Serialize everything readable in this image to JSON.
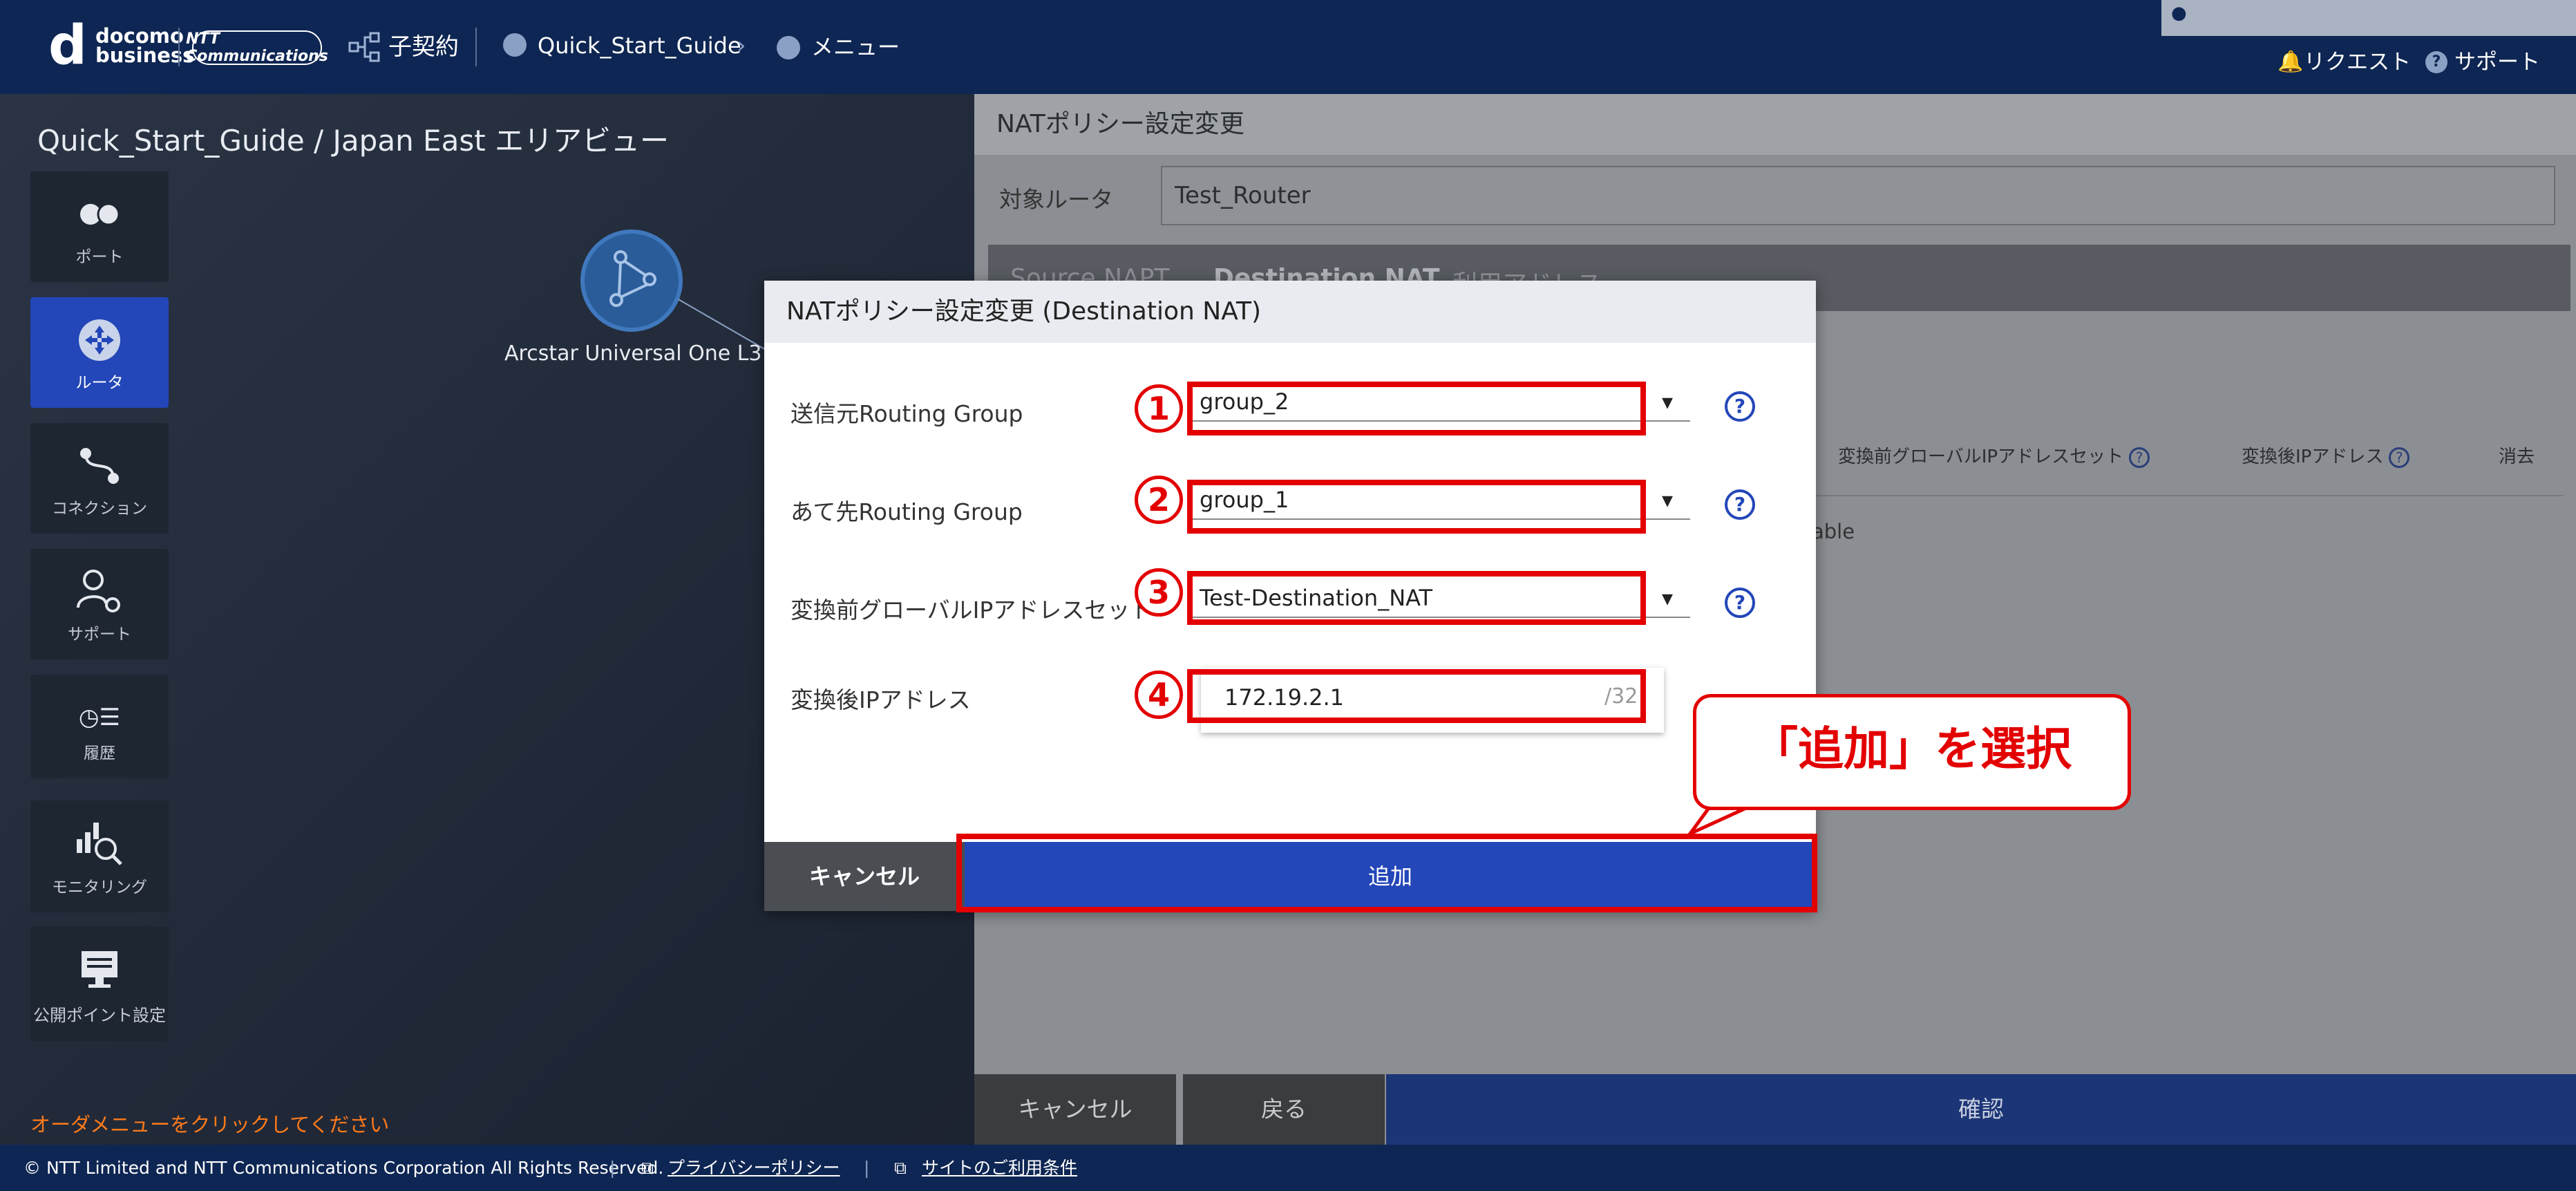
{
  "header": {
    "brand": "docomo business",
    "brand_line1": "docomo",
    "brand_line2": "business",
    "partner_logo": "NTT Communications",
    "nav_contract": "子契約",
    "nav_guide": "Quick_Start_Guide",
    "nav_menu": "メニュー",
    "request": "リクエスト",
    "support": "サポート"
  },
  "left": {
    "area_title": "Quick_Start_Guide / Japan East エリアビュー",
    "sidebar": [
      {
        "label": "ポート",
        "icon": "port-icon"
      },
      {
        "label": "ルータ",
        "icon": "router-icon"
      },
      {
        "label": "コネクション",
        "icon": "connection-icon"
      },
      {
        "label": "サポート",
        "icon": "support-icon"
      },
      {
        "label": "履歴",
        "icon": "history-icon"
      },
      {
        "label": "モニタリング",
        "icon": "monitoring-icon"
      },
      {
        "label": "公開ポイント設定",
        "icon": "public-point-icon"
      }
    ],
    "globe_label": "Arcstar Universal One L3",
    "order_message": "オーダメニューをクリックしてください"
  },
  "right": {
    "title": "NATポリシー設定変更",
    "target_router_label": "対象ルータ",
    "target_router_value": "Test_Router",
    "tabs": [
      "Source NAPT",
      "Destination NAT",
      "利用アドレス"
    ],
    "columns": {
      "pre_global": "変換前グローバルIPアドレスセット",
      "post_ip": "変換後IPアドレス",
      "delete": "消去"
    },
    "table_stub": "able",
    "cancel": "キャンセル",
    "back": "戻る",
    "confirm": "確認"
  },
  "dialog": {
    "title": "NATポリシー設定変更 (Destination NAT)",
    "fields": [
      {
        "label": "送信元Routing Group",
        "value": "group_2",
        "number": "1"
      },
      {
        "label": "あて先Routing Group",
        "value": "group_1",
        "number": "2"
      },
      {
        "label": "変換前グローバルIPアドレスセット",
        "value": "Test-Destination_NAT",
        "number": "3"
      },
      {
        "label": "変換後IPアドレス",
        "value": "172.19.2.1",
        "number": "4"
      }
    ],
    "ip_mask": "/32",
    "help": "?",
    "cancel": "キャンセル",
    "add": "追加"
  },
  "callout": "「追加」を選択",
  "footer": {
    "copyright": "© NTT Limited and NTT Communications Corporation All Rights Reserved.",
    "privacy": "プライバシーポリシー",
    "terms": "サイトのご利用条件"
  }
}
